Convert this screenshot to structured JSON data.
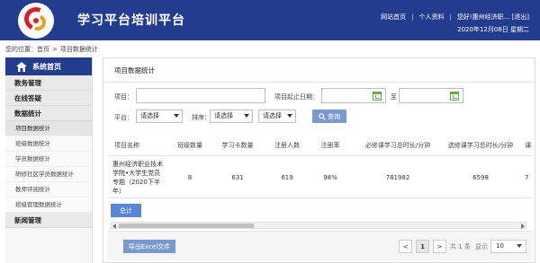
{
  "header": {
    "title": "学习平台培训平台",
    "links": [
      "网站首页",
      "个人资料",
      "您好!惠州经济职...",
      "[退出]"
    ],
    "date": "2020年12月08日 星期二"
  },
  "breadcrumb": {
    "prefix": "您的位置：",
    "home": "首页",
    "current": "项目数据统计"
  },
  "sidebar": {
    "home": "系统首页",
    "items": [
      {
        "type": "category",
        "label": "教务管理"
      },
      {
        "type": "category",
        "label": "在线答疑"
      },
      {
        "type": "category",
        "label": "数据统计"
      },
      {
        "type": "sub",
        "label": "项目数据统计",
        "active": true
      },
      {
        "type": "sub",
        "label": "班级数据统计"
      },
      {
        "type": "sub",
        "label": "学员数据统计"
      },
      {
        "type": "sub",
        "label": "研修社区学员数据统计"
      },
      {
        "type": "sub",
        "label": "教师评阅统计"
      },
      {
        "type": "sub",
        "label": "班级管理数据统计"
      },
      {
        "type": "category",
        "label": "新闻管理"
      }
    ]
  },
  "panel": {
    "title": "项目数据统计",
    "filters": {
      "project_label": "项目：",
      "date_label": "项目起止日期：",
      "to_label": "至",
      "platform_label": "平台：",
      "platform_value": "请选择",
      "sort_label": "排序：",
      "sort_value": "请选择",
      "order_value": "请选择",
      "query_button": "查询"
    },
    "table": {
      "columns": [
        "项目名称",
        "班级数量",
        "学习卡数量",
        "注册人数",
        "注册率",
        "必修课学习总时长/分钟",
        "选修课学习总时长/分钟",
        "课程学习"
      ],
      "rows": [
        [
          "惠州经济职业技术学院•大学生党员专题（2020下半年）",
          "8",
          "631",
          "619",
          "98%",
          "781982",
          "6598",
          "7"
        ]
      ]
    },
    "total_button": "总计",
    "export_button": "导出Excel文件",
    "pagination": {
      "prev": "<",
      "current": "1",
      "next": ">",
      "total": "共 1 条",
      "show_label": "显示",
      "page_size": "10"
    }
  }
}
